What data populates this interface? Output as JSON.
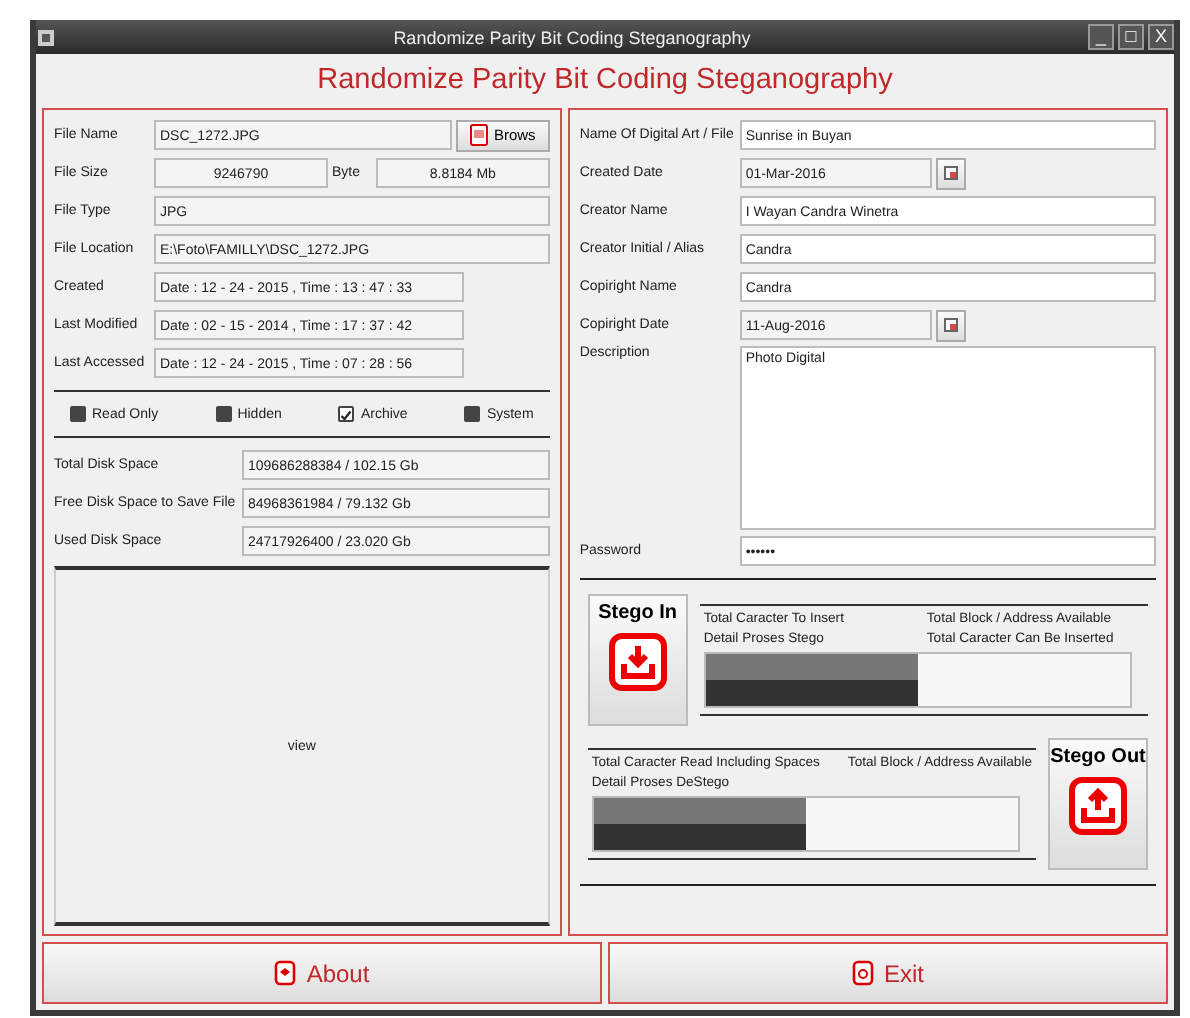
{
  "window": {
    "title": "Randomize Parity Bit Coding Steganography",
    "controls": [
      "_",
      "□",
      "X"
    ]
  },
  "heading": "Randomize Parity Bit Coding Steganography",
  "file": {
    "name_label": "File Name",
    "name": "DSC_1272.JPG",
    "browse": "Brows",
    "size_label": "File Size",
    "size_bytes": "9246790",
    "byte_label": "Byte",
    "size_mb": "8.8184 Mb",
    "type_label": "File Type",
    "type": "JPG",
    "location_label": "File Location",
    "location": "E:\\Foto\\FAMILLY\\DSC_1272.JPG",
    "created_label": "Created",
    "created": "Date : 12 - 24 - 2015 , Time : 13 : 47 : 33",
    "modified_label": "Last Modified",
    "modified": "Date : 02 - 15 - 2014 , Time : 17 : 37 : 42",
    "accessed_label": "Last Accessed",
    "accessed": "Date : 12 - 24 - 2015 , Time : 07 : 28 : 56"
  },
  "attributes": [
    {
      "label": "Read Only",
      "checked": false
    },
    {
      "label": "Hidden",
      "checked": false
    },
    {
      "label": "Archive",
      "checked": true
    },
    {
      "label": "System",
      "checked": false
    }
  ],
  "disk": [
    {
      "label": "Total Disk Space",
      "value": "109686288384 / 102.15 Gb"
    },
    {
      "label": "Free Disk Space to Save File",
      "value": "84968361984 / 79.132 Gb"
    },
    {
      "label": "Used Disk Space",
      "value": "24717926400 / 23.020 Gb"
    }
  ],
  "preview": "view",
  "metadata": [
    {
      "label": "Name Of Digital Art / File",
      "value": "Sunrise in Buyan",
      "kind": "text"
    },
    {
      "label": "Created Date",
      "value": "01-Mar-2016",
      "kind": "date"
    },
    {
      "label": "Creator Name",
      "value": "I Wayan Candra Winetra",
      "kind": "text"
    },
    {
      "label": "Creator Initial / Alias",
      "value": "Candra",
      "kind": "text"
    },
    {
      "label": "Copiright Name",
      "value": "Candra",
      "kind": "text"
    },
    {
      "label": "Copiright Date",
      "value": "11-Aug-2016",
      "kind": "date"
    },
    {
      "label": "Description",
      "value": "Photo Digital",
      "kind": "area"
    },
    {
      "label": "Password",
      "value": "••••••",
      "kind": "text"
    }
  ],
  "stego_in": {
    "button": "Stego In",
    "labels": [
      "Total Caracter To Insert",
      "Total Block / Address Available",
      "Detail Proses Stego",
      "Total Caracter Can Be Inserted"
    ],
    "level": 0.5
  },
  "stego_out": {
    "button": "Stego Out",
    "labels": [
      "Total Caracter Read Including Spaces",
      "Total Block / Address Available",
      "Detail Proses DeStego"
    ],
    "level": 0.5
  },
  "footer": [
    "About",
    "Exit"
  ]
}
